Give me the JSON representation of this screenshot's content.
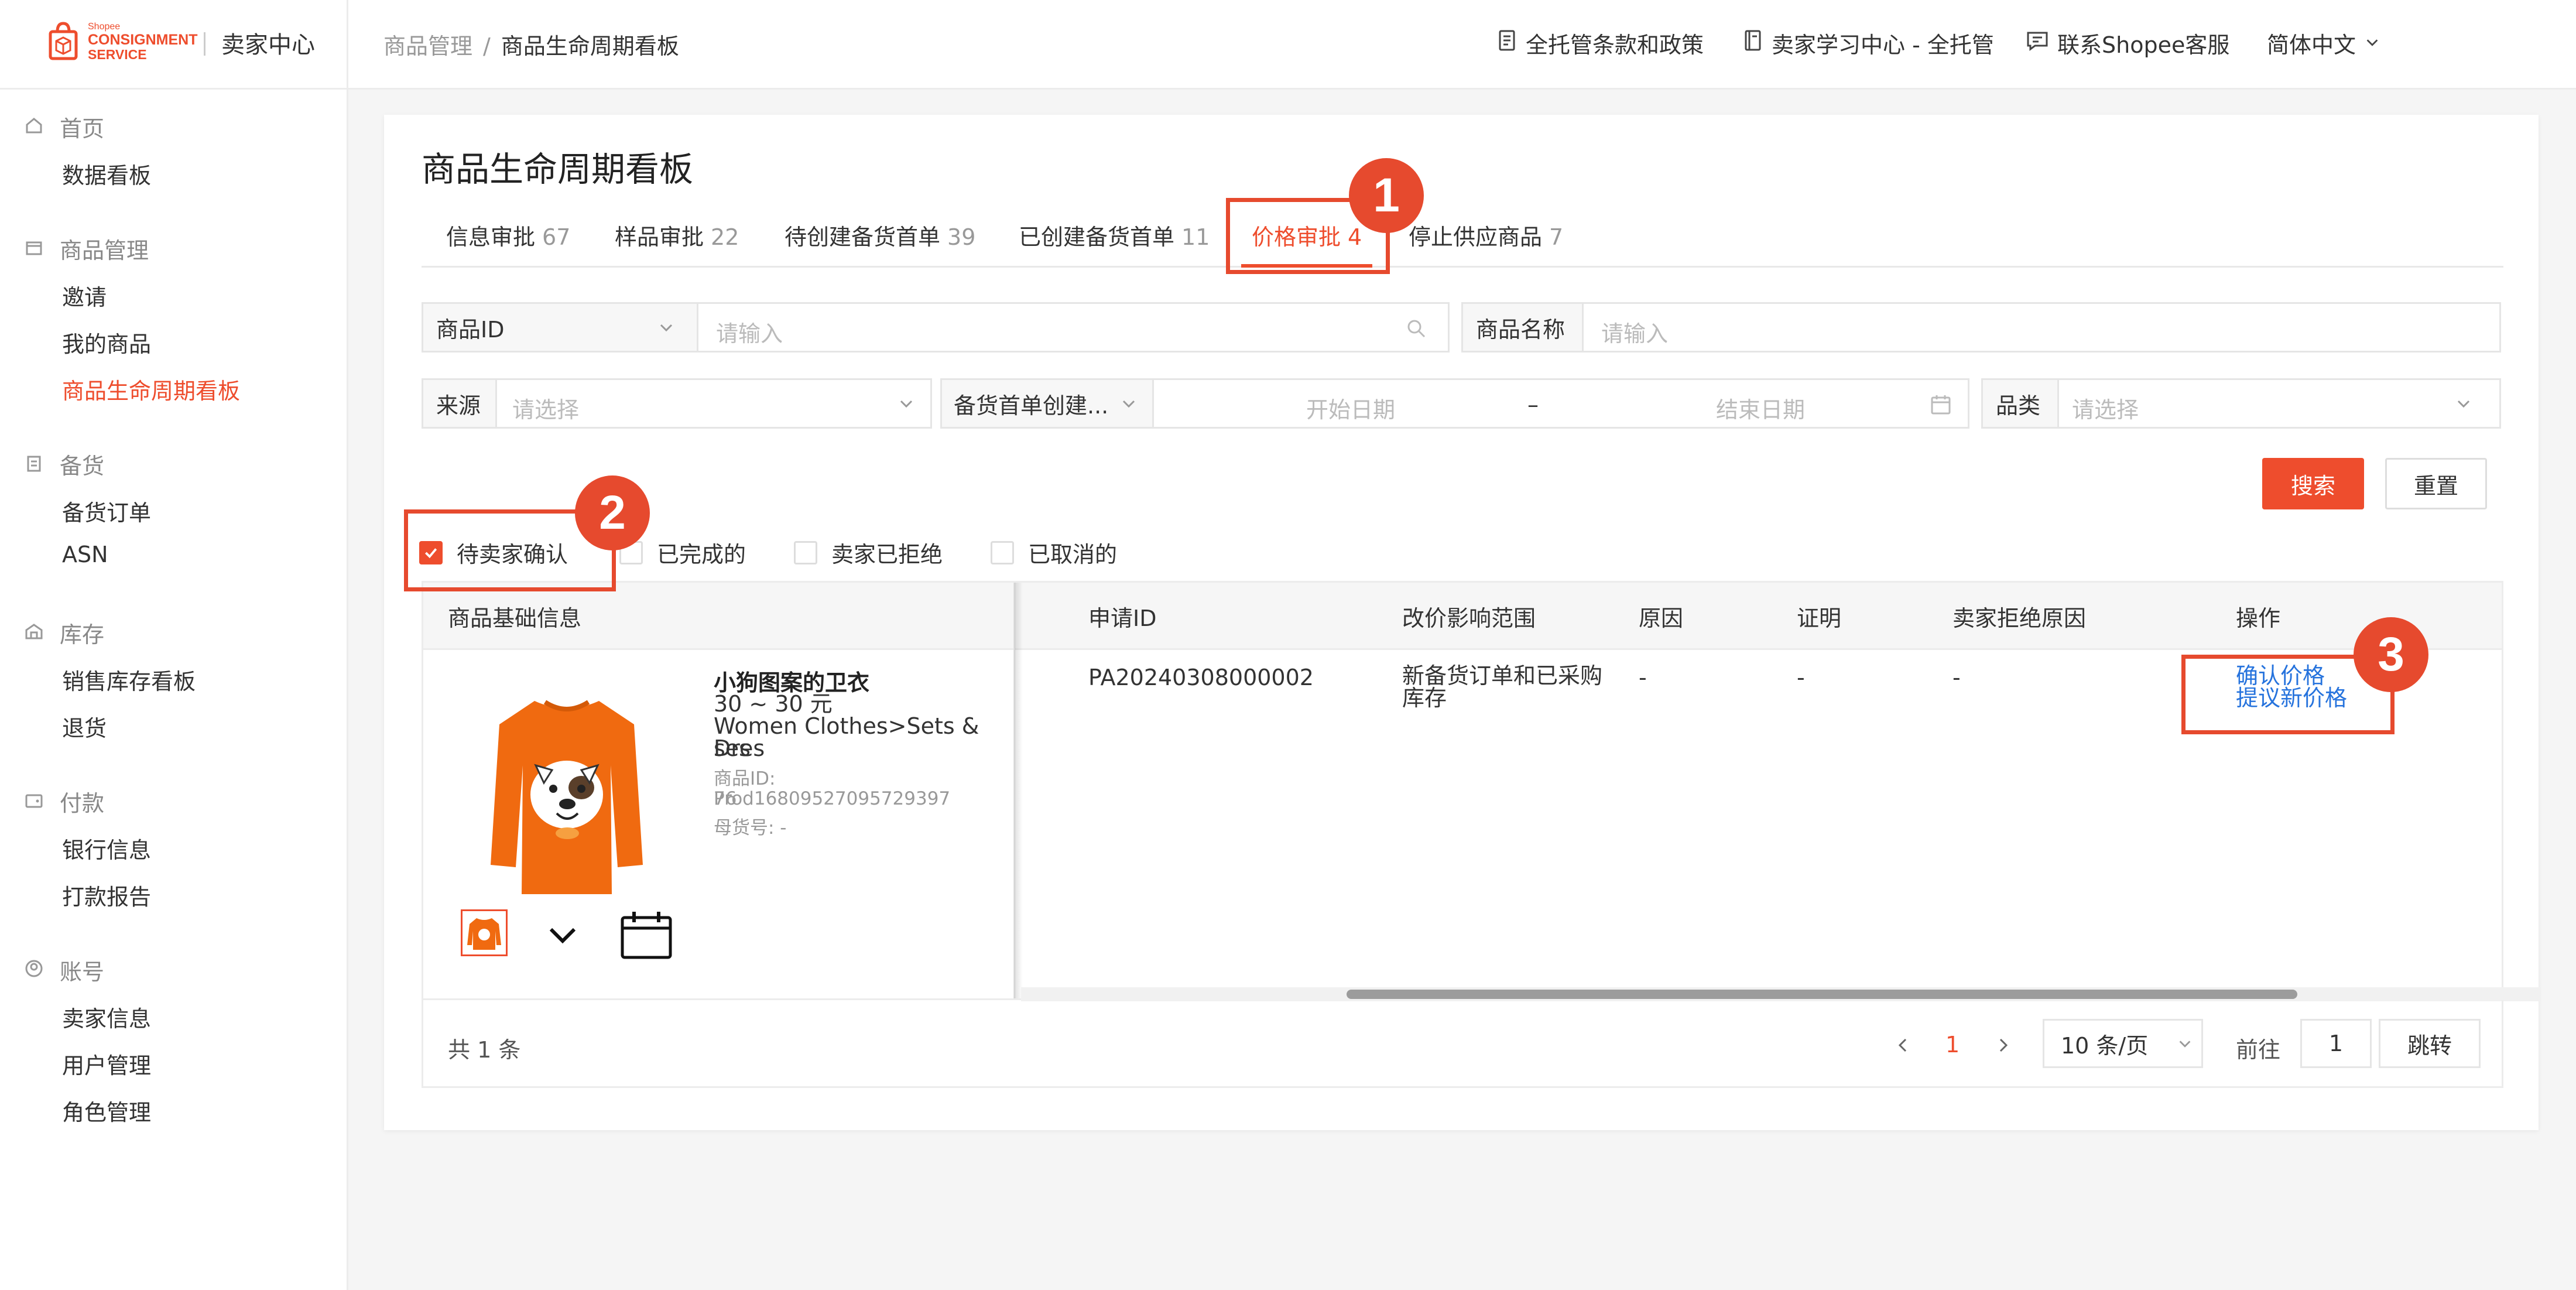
{
  "brand": {
    "line1": "Shopee",
    "line2": "CONSIGNMENT",
    "line3": "SERVICE",
    "app_name": "卖家中心",
    "accent": "#ee4d2d",
    "link_color": "#2673dd"
  },
  "breadcrumb": {
    "root": "商品管理",
    "sep": "/",
    "current": "商品生命周期看板"
  },
  "header_links": [
    "全托管条款和政策",
    "卖家学习中心 - 全托管",
    "联系Shopee客服"
  ],
  "language": "简体中文",
  "sidebar": {
    "groups": [
      {
        "label": "首页",
        "icon": "home-icon",
        "items": [
          "数据看板"
        ]
      },
      {
        "label": "商品管理",
        "icon": "box-icon",
        "items": [
          "邀请",
          "我的商品",
          "商品生命周期看板"
        ]
      },
      {
        "label": "备货",
        "icon": "clipboard-icon",
        "items": [
          "备货订单",
          "ASN"
        ]
      },
      {
        "label": "库存",
        "icon": "warehouse-icon",
        "items": [
          "销售库存看板",
          "退货"
        ]
      },
      {
        "label": "付款",
        "icon": "wallet-icon",
        "items": [
          "银行信息",
          "打款报告"
        ]
      },
      {
        "label": "账号",
        "icon": "user-icon",
        "items": [
          "卖家信息",
          "用户管理",
          "角色管理"
        ]
      }
    ],
    "active_item": "商品生命周期看板"
  },
  "page_title": "商品生命周期看板",
  "tabs": [
    {
      "label": "信息审批",
      "count": "67"
    },
    {
      "label": "样品审批",
      "count": "22"
    },
    {
      "label": "待创建备货首单",
      "count": "39"
    },
    {
      "label": "已创建备货首单",
      "count": "11"
    },
    {
      "label": "价格审批",
      "count": "4"
    },
    {
      "label": "停止供应商品",
      "count": "7"
    }
  ],
  "active_tab": "价格审批",
  "search": {
    "id_field": {
      "type": "商品ID",
      "placeholder": "请输入"
    },
    "name_field": {
      "label": "商品名称",
      "placeholder": "请输入"
    },
    "source": {
      "label": "来源",
      "placeholder": "请选择"
    },
    "date": {
      "type": "备货首单创建...",
      "start": "开始日期",
      "dash": "–",
      "end": "结束日期"
    },
    "category": {
      "label": "品类",
      "placeholder": "请选择"
    },
    "search_btn": "搜索",
    "reset_btn": "重置"
  },
  "status_filters": [
    {
      "label": "待卖家确认",
      "checked": true
    },
    {
      "label": "已完成的",
      "checked": false
    },
    {
      "label": "卖家已拒绝",
      "checked": false
    },
    {
      "label": "已取消的",
      "checked": false
    }
  ],
  "table": {
    "columns": [
      "商品基础信息",
      "申请ID",
      "改价影响范围",
      "原因",
      "证明",
      "卖家拒绝原因",
      "操作"
    ],
    "rows": [
      {
        "product_name": "小狗图案的卫衣",
        "price": "30 ~ 30 元",
        "category_l1": "Women Clothes>Sets & Dres",
        "category_l2": "ses",
        "product_id_l1": "商品ID: Prod16809527095729397",
        "product_id_l2": "76",
        "parent_sku": "母货号: -",
        "request_id": "PA20240308000002",
        "scope_l1": "新备货订单和已采购",
        "scope_l2": "库存",
        "reason": "-",
        "proof": "-",
        "reject_reason": "-",
        "actions": [
          "确认价格",
          "提议新价格"
        ]
      }
    ]
  },
  "pagination": {
    "total": "共 1 条",
    "current": "1",
    "page_size": "10 条/页",
    "goto_label": "前往",
    "goto_value": "1",
    "jump_btn": "跳转"
  },
  "callouts": [
    "1",
    "2",
    "3"
  ]
}
